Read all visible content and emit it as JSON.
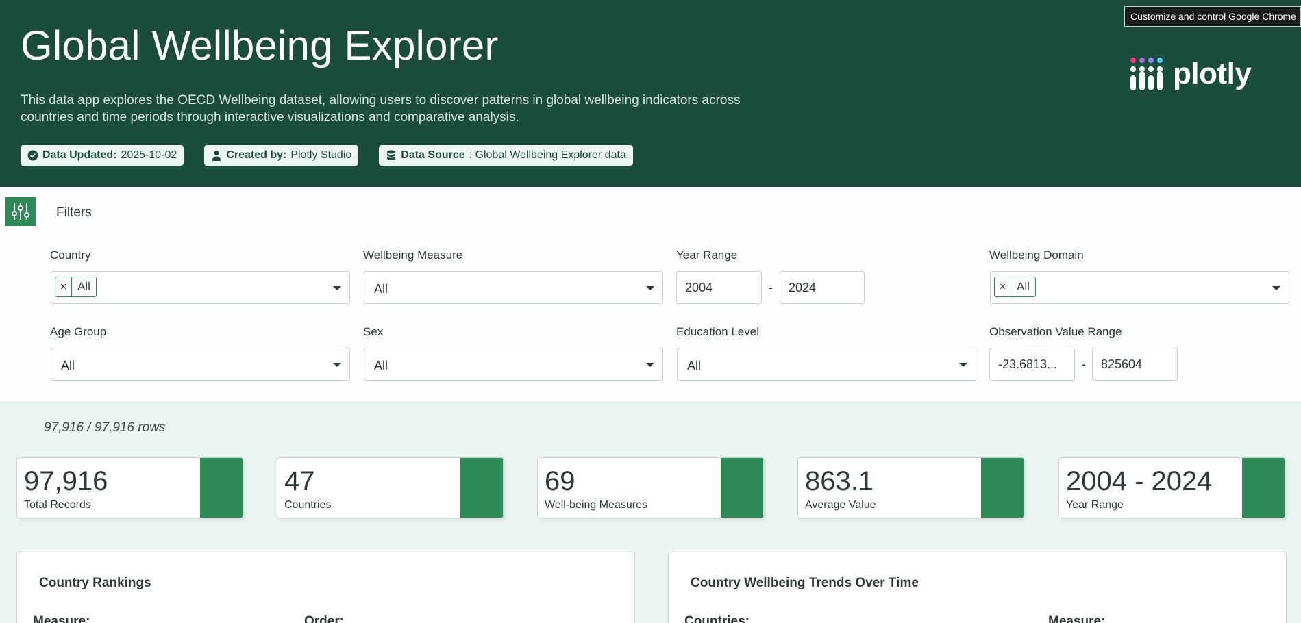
{
  "tooltip": "Customize and control Google Chrome",
  "header": {
    "title": "Global Wellbeing Explorer",
    "description": "This data app explores the OECD Wellbeing dataset, allowing users to discover patterns in global wellbeing indicators across countries and time periods through interactive visualizations and comparative analysis.",
    "badges": [
      {
        "label": "Data Updated:",
        "value": " 2025-10-02"
      },
      {
        "label": "Created by:",
        "value": " Plotly Studio"
      },
      {
        "label": "Data Source",
        "value": ": Global Wellbeing Explorer data"
      }
    ],
    "logo_text": "plotly"
  },
  "filters": {
    "label": "Filters",
    "country": {
      "label": "Country",
      "chip": "All",
      "chip_x": "×"
    },
    "measure": {
      "label": "Wellbeing Measure",
      "value": "All"
    },
    "year_range": {
      "label": "Year Range",
      "from": "2004",
      "to": "2024",
      "sep": "-"
    },
    "domain": {
      "label": "Wellbeing Domain",
      "chip": "All",
      "chip_x": "×"
    },
    "age": {
      "label": "Age Group",
      "value": "All"
    },
    "sex": {
      "label": "Sex",
      "value": "All"
    },
    "education": {
      "label": "Education Level",
      "value": "All"
    },
    "obs_range": {
      "label": "Observation Value Range",
      "from": "-23.6813...",
      "to": "825604",
      "sep": "-"
    }
  },
  "rows_text": "97,916 / 97,916 rows",
  "kpis": [
    {
      "value": "97,916",
      "label": "Total Records"
    },
    {
      "value": "47",
      "label": "Countries"
    },
    {
      "value": "69",
      "label": "Well-being Measures"
    },
    {
      "value": "863.1",
      "label": "Average Value"
    },
    {
      "value": "2004 - 2024",
      "label": "Year Range"
    }
  ],
  "cards": [
    {
      "title": "Country Rankings",
      "label1": "Measure:",
      "label2": "Order:"
    },
    {
      "title": "Country Wellbeing Trends Over Time",
      "label1": "Countries:",
      "label2": "Measure:"
    }
  ],
  "colors": {
    "header_bg": "#1b4d3e",
    "accent": "#2e8b57",
    "page_bg": "#eaf4f0"
  }
}
